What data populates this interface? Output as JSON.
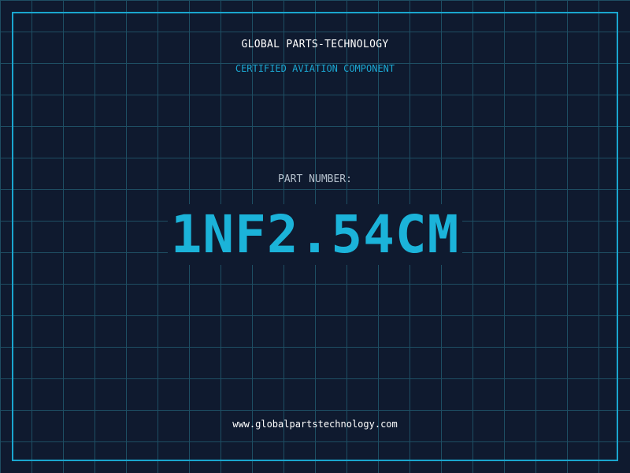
{
  "header": {
    "company": "GLOBAL PARTS-TECHNOLOGY",
    "subtitle": "CERTIFIED AVIATION COMPONENT"
  },
  "part": {
    "label": "PART NUMBER:",
    "number": "1NF2.54CM"
  },
  "footer": {
    "url": "www.globalpartstechnology.com"
  },
  "colors": {
    "background": "#0f1a2f",
    "grid": "#1e4e63",
    "accent": "#1aa6cf",
    "text": "#ffffff",
    "label": "#b4c0cc"
  }
}
